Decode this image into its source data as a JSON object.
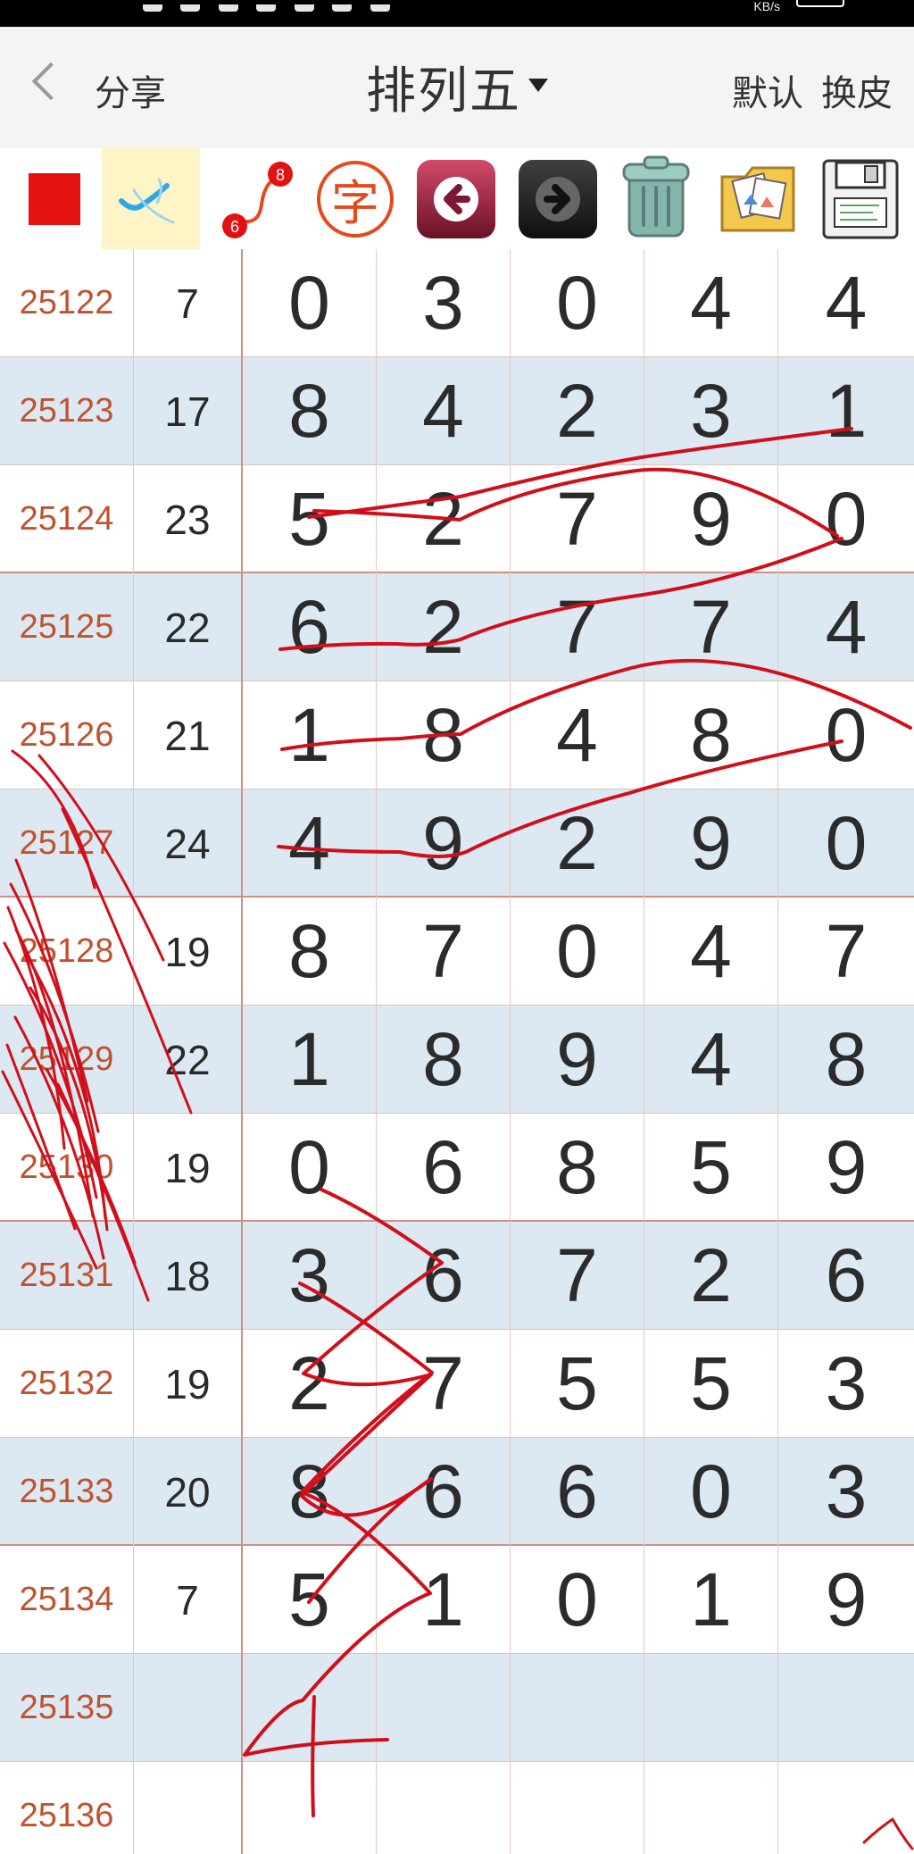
{
  "status_bar": {
    "speed": "KB/s"
  },
  "header": {
    "back_label": "分享",
    "title": "排列五",
    "default_label": "默认",
    "skin_label": "换皮"
  },
  "toolbar": {
    "char_icon_label": "字",
    "connect_icon_top": "8",
    "connect_icon_bottom": "6"
  },
  "rows": [
    {
      "period": "25122",
      "sum": "7",
      "digits": [
        "0",
        "3",
        "0",
        "4",
        "4"
      ]
    },
    {
      "period": "25123",
      "sum": "17",
      "digits": [
        "8",
        "4",
        "2",
        "3",
        "1"
      ]
    },
    {
      "period": "25124",
      "sum": "23",
      "digits": [
        "5",
        "2",
        "7",
        "9",
        "0"
      ]
    },
    {
      "period": "25125",
      "sum": "22",
      "digits": [
        "6",
        "2",
        "7",
        "7",
        "4"
      ]
    },
    {
      "period": "25126",
      "sum": "21",
      "digits": [
        "1",
        "8",
        "4",
        "8",
        "0"
      ]
    },
    {
      "period": "25127",
      "sum": "24",
      "digits": [
        "4",
        "9",
        "2",
        "9",
        "0"
      ]
    },
    {
      "period": "25128",
      "sum": "19",
      "digits": [
        "8",
        "7",
        "0",
        "4",
        "7"
      ]
    },
    {
      "period": "25129",
      "sum": "22",
      "digits": [
        "1",
        "8",
        "9",
        "4",
        "8"
      ]
    },
    {
      "period": "25130",
      "sum": "19",
      "digits": [
        "0",
        "6",
        "8",
        "5",
        "9"
      ]
    },
    {
      "period": "25131",
      "sum": "18",
      "digits": [
        "3",
        "6",
        "7",
        "2",
        "6"
      ]
    },
    {
      "period": "25132",
      "sum": "19",
      "digits": [
        "2",
        "7",
        "5",
        "5",
        "3"
      ]
    },
    {
      "period": "25133",
      "sum": "20",
      "digits": [
        "8",
        "6",
        "6",
        "0",
        "3"
      ]
    },
    {
      "period": "25134",
      "sum": "7",
      "digits": [
        "5",
        "1",
        "0",
        "1",
        "9"
      ]
    },
    {
      "period": "25135",
      "sum": "",
      "digits": [
        "",
        "",
        "",
        "",
        ""
      ]
    },
    {
      "period": "25136",
      "sum": "",
      "digits": [
        "",
        "",
        "",
        "",
        ""
      ]
    }
  ]
}
